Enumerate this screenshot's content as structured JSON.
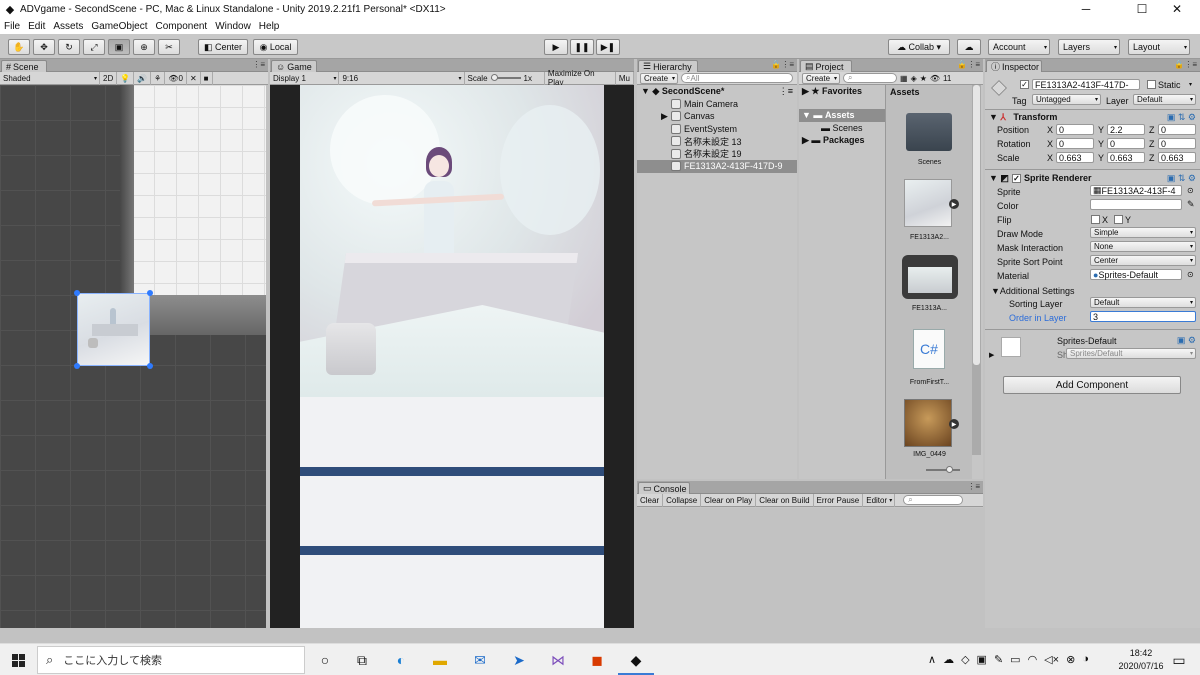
{
  "window": {
    "title": "ADVgame - SecondScene - PC, Mac & Linux Standalone - Unity 2019.2.21f1 Personal* <DX11>",
    "minimize": "─",
    "maximize": "☐",
    "close": "✕"
  },
  "menu": [
    "File",
    "Edit",
    "Assets",
    "GameObject",
    "Component",
    "Window",
    "Help"
  ],
  "toolbar": {
    "pivot": "Center",
    "space": "Local",
    "collab": "Collab ▾",
    "account": "Account",
    "layers": "Layers",
    "layout": "Layout"
  },
  "scene": {
    "tab": "Scene",
    "shading": "Shaded",
    "mode2d": "2D",
    "gizmo_count": "0"
  },
  "game": {
    "tab": "Game",
    "display": "Display 1",
    "aspect": "9:16",
    "scale_label": "Scale",
    "scale_value": "1x",
    "maximize": "Maximize On Play",
    "mute": "Mu"
  },
  "hierarchy": {
    "tab": "Hierarchy",
    "create": "Create",
    "search": "All",
    "scene_name": "SecondScene*",
    "items": [
      "Main Camera",
      "Canvas",
      "EventSystem",
      "名称未設定 13",
      "名称未設定 19",
      "FE1313A2-413F-417D-9"
    ]
  },
  "project": {
    "tab": "Project",
    "create": "Create",
    "count": "11",
    "favorites": "Favorites",
    "assets": "Assets",
    "scenes": "Scenes",
    "packages": "Packages",
    "header": "Assets",
    "files": [
      "Scenes",
      "FE1313A2...",
      "FE1313A...",
      "FromFirstT...",
      "IMG_0449"
    ]
  },
  "console": {
    "tab": "Console",
    "buttons": [
      "Clear",
      "Collapse",
      "Clear on Play",
      "Clear on Build",
      "Error Pause",
      "Editor"
    ]
  },
  "inspector": {
    "tab": "Inspector",
    "name": "FE1313A2-413F-417D-",
    "static": "Static",
    "tag_label": "Tag",
    "tag": "Untagged",
    "layer_label": "Layer",
    "layer": "Default",
    "transform": {
      "title": "Transform",
      "position": "Position",
      "rotation": "Rotation",
      "scale": "Scale",
      "pos": [
        "0",
        "2.2",
        "0"
      ],
      "rot": [
        "0",
        "0",
        "0"
      ],
      "scl": [
        "0.663",
        "0.663",
        "0.663"
      ],
      "x": "X",
      "y": "Y",
      "z": "Z"
    },
    "sprite_renderer": {
      "title": "Sprite Renderer",
      "sprite_label": "Sprite",
      "sprite": "FE1313A2-413F-4",
      "color": "Color",
      "flip": "Flip",
      "flip_x": "X",
      "flip_y": "Y",
      "draw_mode": "Draw Mode",
      "draw_mode_value": "Simple",
      "mask": "Mask Interaction",
      "mask_value": "None",
      "sort_point": "Sprite Sort Point",
      "sort_point_value": "Center",
      "material": "Material",
      "material_value": "Sprites-Default",
      "additional": "Additional Settings",
      "sorting_layer": "Sorting Layer",
      "sorting_layer_value": "Default",
      "order": "Order in Layer",
      "order_value": "3"
    },
    "material_block": {
      "name": "Sprites-Default",
      "shader_label": "Shader",
      "shader": "Sprites/Default"
    },
    "add_component": "Add Component"
  },
  "taskbar": {
    "search": "ここに入力して検索",
    "time": "18:42",
    "date": "2020/07/16"
  }
}
